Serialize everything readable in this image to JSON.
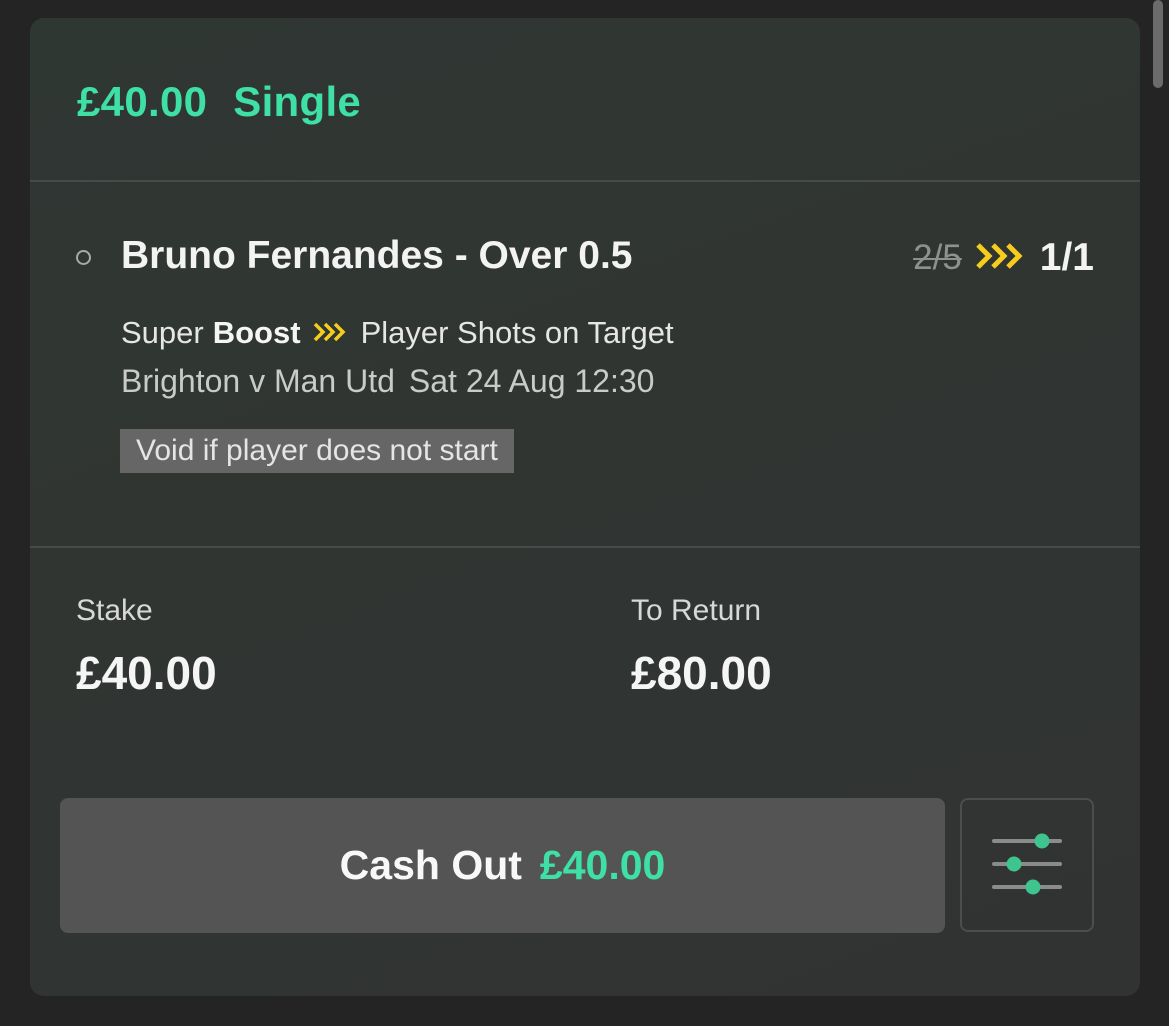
{
  "bet": {
    "stake_header": "£40.00",
    "bet_type": "Single"
  },
  "selection": {
    "name": "Bruno Fernandes - Over 0.5",
    "old_odds": "2/5",
    "new_odds": "1/1",
    "boost_prefix": "Super",
    "boost_word": "Boost",
    "market": "Player Shots on Target",
    "event": "Brighton v Man Utd",
    "event_time": "Sat 24 Aug 12:30",
    "void_note": "Void if player does not start"
  },
  "summary": {
    "stake_label": "Stake",
    "stake_value": "£40.00",
    "return_label": "To Return",
    "return_value": "£80.00"
  },
  "cashout": {
    "label": "Cash Out",
    "amount": "£40.00"
  },
  "icons": {
    "boost": "boost-chevrons-icon",
    "settings": "sliders-icon"
  },
  "colors": {
    "accent_green": "#3ee0a6",
    "boost_yellow": "#f5cd1c",
    "card_background": "#303532",
    "page_background": "#242424"
  }
}
